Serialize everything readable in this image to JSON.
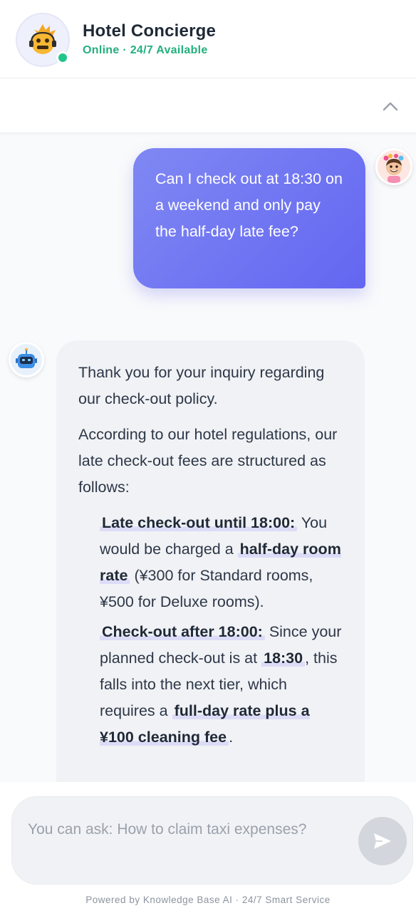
{
  "header": {
    "title": "Hotel Concierge",
    "status": "Online · 24/7 Available",
    "avatar_icon": "concierge-mascot-icon",
    "online_color": "#22c58b"
  },
  "subbar": {
    "toggle_icon": "chevron-up-icon"
  },
  "messages": {
    "user": {
      "text": "Can I check out at 18:30 on a weekend and only pay the half-day late fee?",
      "avatar_icon": "user-avatar-icon"
    },
    "bot": {
      "avatar_icon": "robot-icon",
      "para1": "Thank you for your inquiry regarding our check-out policy.",
      "para2": "According to our hotel regulations, our late check-out fees are structured as follows:",
      "item1": {
        "heading": "Late check-out until 18:00:",
        "text_a": "You would be charged a",
        "hl": "half-day room rate",
        "text_b": "(¥300 for Standard rooms, ¥500 for Deluxe rooms)."
      },
      "item2": {
        "heading": "Check-out after 18:00:",
        "text_a": "Since your planned check-out is at",
        "hl1": "18:30",
        "text_b": ", this falls into the next tier, which requires a",
        "hl2": "full-day rate plus a ¥100 cleaning fee",
        "text_c": "."
      }
    }
  },
  "input": {
    "placeholder": "You can ask: How to claim taxi expenses?",
    "value": "",
    "send_icon": "send-icon"
  },
  "footer": {
    "text": "Powered by Knowledge Base AI · 24/7 Smart Service"
  },
  "colors": {
    "accent": "#6366f1",
    "accent_light": "#8088f3",
    "status_green": "#22b07d",
    "highlight": "#dcdcf7"
  }
}
